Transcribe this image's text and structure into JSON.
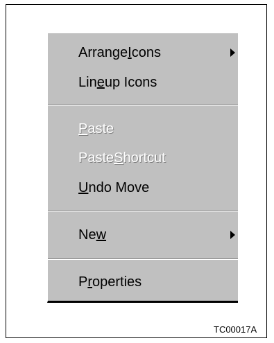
{
  "menu": {
    "arrange": {
      "pre": "Arrange ",
      "mn": "I",
      "post": "cons"
    },
    "lineup": {
      "pre": "Lin",
      "mn": "e",
      "post": " up Icons"
    },
    "paste": {
      "pre": "",
      "mn": "P",
      "post": "aste"
    },
    "paste_shortcut": {
      "pre": "Paste ",
      "mn": "S",
      "post": "hortcut"
    },
    "undo": {
      "pre": "",
      "mn": "U",
      "post": "ndo Move"
    },
    "new": {
      "pre": "Ne",
      "mn": "w",
      "post": ""
    },
    "properties": {
      "pre": "P",
      "mn": "r",
      "post": "operties"
    }
  },
  "figure_code": "TC00017A",
  "icons": {
    "submenu": "triangle-right-icon"
  },
  "colors": {
    "menu_bg": "#c0c0c0",
    "text": "#000000",
    "disabled": "#ffffff",
    "shadow": "#808080"
  }
}
